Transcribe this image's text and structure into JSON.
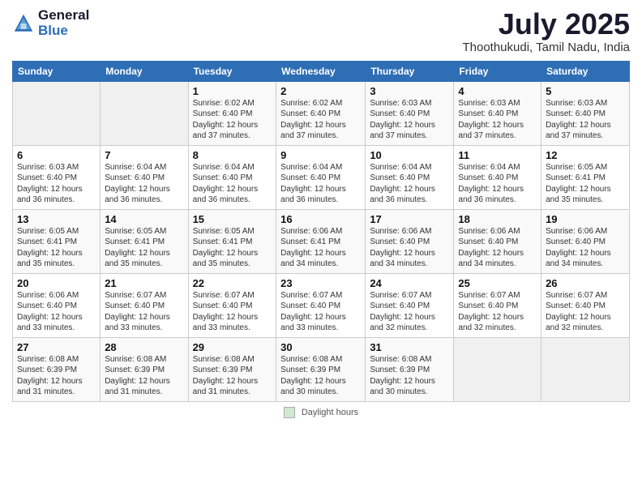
{
  "header": {
    "logo_general": "General",
    "logo_blue": "Blue",
    "title": "July 2025",
    "subtitle": "Thoothukudi, Tamil Nadu, India"
  },
  "days_of_week": [
    "Sunday",
    "Monday",
    "Tuesday",
    "Wednesday",
    "Thursday",
    "Friday",
    "Saturday"
  ],
  "footer": {
    "label": "Daylight hours"
  },
  "weeks": [
    [
      {
        "day": "",
        "sunrise": "",
        "sunset": "",
        "daylight": ""
      },
      {
        "day": "",
        "sunrise": "",
        "sunset": "",
        "daylight": ""
      },
      {
        "day": "1",
        "sunrise": "Sunrise: 6:02 AM",
        "sunset": "Sunset: 6:40 PM",
        "daylight": "Daylight: 12 hours and 37 minutes."
      },
      {
        "day": "2",
        "sunrise": "Sunrise: 6:02 AM",
        "sunset": "Sunset: 6:40 PM",
        "daylight": "Daylight: 12 hours and 37 minutes."
      },
      {
        "day": "3",
        "sunrise": "Sunrise: 6:03 AM",
        "sunset": "Sunset: 6:40 PM",
        "daylight": "Daylight: 12 hours and 37 minutes."
      },
      {
        "day": "4",
        "sunrise": "Sunrise: 6:03 AM",
        "sunset": "Sunset: 6:40 PM",
        "daylight": "Daylight: 12 hours and 37 minutes."
      },
      {
        "day": "5",
        "sunrise": "Sunrise: 6:03 AM",
        "sunset": "Sunset: 6:40 PM",
        "daylight": "Daylight: 12 hours and 37 minutes."
      }
    ],
    [
      {
        "day": "6",
        "sunrise": "Sunrise: 6:03 AM",
        "sunset": "Sunset: 6:40 PM",
        "daylight": "Daylight: 12 hours and 36 minutes."
      },
      {
        "day": "7",
        "sunrise": "Sunrise: 6:04 AM",
        "sunset": "Sunset: 6:40 PM",
        "daylight": "Daylight: 12 hours and 36 minutes."
      },
      {
        "day": "8",
        "sunrise": "Sunrise: 6:04 AM",
        "sunset": "Sunset: 6:40 PM",
        "daylight": "Daylight: 12 hours and 36 minutes."
      },
      {
        "day": "9",
        "sunrise": "Sunrise: 6:04 AM",
        "sunset": "Sunset: 6:40 PM",
        "daylight": "Daylight: 12 hours and 36 minutes."
      },
      {
        "day": "10",
        "sunrise": "Sunrise: 6:04 AM",
        "sunset": "Sunset: 6:40 PM",
        "daylight": "Daylight: 12 hours and 36 minutes."
      },
      {
        "day": "11",
        "sunrise": "Sunrise: 6:04 AM",
        "sunset": "Sunset: 6:40 PM",
        "daylight": "Daylight: 12 hours and 36 minutes."
      },
      {
        "day": "12",
        "sunrise": "Sunrise: 6:05 AM",
        "sunset": "Sunset: 6:41 PM",
        "daylight": "Daylight: 12 hours and 35 minutes."
      }
    ],
    [
      {
        "day": "13",
        "sunrise": "Sunrise: 6:05 AM",
        "sunset": "Sunset: 6:41 PM",
        "daylight": "Daylight: 12 hours and 35 minutes."
      },
      {
        "day": "14",
        "sunrise": "Sunrise: 6:05 AM",
        "sunset": "Sunset: 6:41 PM",
        "daylight": "Daylight: 12 hours and 35 minutes."
      },
      {
        "day": "15",
        "sunrise": "Sunrise: 6:05 AM",
        "sunset": "Sunset: 6:41 PM",
        "daylight": "Daylight: 12 hours and 35 minutes."
      },
      {
        "day": "16",
        "sunrise": "Sunrise: 6:06 AM",
        "sunset": "Sunset: 6:41 PM",
        "daylight": "Daylight: 12 hours and 34 minutes."
      },
      {
        "day": "17",
        "sunrise": "Sunrise: 6:06 AM",
        "sunset": "Sunset: 6:40 PM",
        "daylight": "Daylight: 12 hours and 34 minutes."
      },
      {
        "day": "18",
        "sunrise": "Sunrise: 6:06 AM",
        "sunset": "Sunset: 6:40 PM",
        "daylight": "Daylight: 12 hours and 34 minutes."
      },
      {
        "day": "19",
        "sunrise": "Sunrise: 6:06 AM",
        "sunset": "Sunset: 6:40 PM",
        "daylight": "Daylight: 12 hours and 34 minutes."
      }
    ],
    [
      {
        "day": "20",
        "sunrise": "Sunrise: 6:06 AM",
        "sunset": "Sunset: 6:40 PM",
        "daylight": "Daylight: 12 hours and 33 minutes."
      },
      {
        "day": "21",
        "sunrise": "Sunrise: 6:07 AM",
        "sunset": "Sunset: 6:40 PM",
        "daylight": "Daylight: 12 hours and 33 minutes."
      },
      {
        "day": "22",
        "sunrise": "Sunrise: 6:07 AM",
        "sunset": "Sunset: 6:40 PM",
        "daylight": "Daylight: 12 hours and 33 minutes."
      },
      {
        "day": "23",
        "sunrise": "Sunrise: 6:07 AM",
        "sunset": "Sunset: 6:40 PM",
        "daylight": "Daylight: 12 hours and 33 minutes."
      },
      {
        "day": "24",
        "sunrise": "Sunrise: 6:07 AM",
        "sunset": "Sunset: 6:40 PM",
        "daylight": "Daylight: 12 hours and 32 minutes."
      },
      {
        "day": "25",
        "sunrise": "Sunrise: 6:07 AM",
        "sunset": "Sunset: 6:40 PM",
        "daylight": "Daylight: 12 hours and 32 minutes."
      },
      {
        "day": "26",
        "sunrise": "Sunrise: 6:07 AM",
        "sunset": "Sunset: 6:40 PM",
        "daylight": "Daylight: 12 hours and 32 minutes."
      }
    ],
    [
      {
        "day": "27",
        "sunrise": "Sunrise: 6:08 AM",
        "sunset": "Sunset: 6:39 PM",
        "daylight": "Daylight: 12 hours and 31 minutes."
      },
      {
        "day": "28",
        "sunrise": "Sunrise: 6:08 AM",
        "sunset": "Sunset: 6:39 PM",
        "daylight": "Daylight: 12 hours and 31 minutes."
      },
      {
        "day": "29",
        "sunrise": "Sunrise: 6:08 AM",
        "sunset": "Sunset: 6:39 PM",
        "daylight": "Daylight: 12 hours and 31 minutes."
      },
      {
        "day": "30",
        "sunrise": "Sunrise: 6:08 AM",
        "sunset": "Sunset: 6:39 PM",
        "daylight": "Daylight: 12 hours and 30 minutes."
      },
      {
        "day": "31",
        "sunrise": "Sunrise: 6:08 AM",
        "sunset": "Sunset: 6:39 PM",
        "daylight": "Daylight: 12 hours and 30 minutes."
      },
      {
        "day": "",
        "sunrise": "",
        "sunset": "",
        "daylight": ""
      },
      {
        "day": "",
        "sunrise": "",
        "sunset": "",
        "daylight": ""
      }
    ]
  ]
}
